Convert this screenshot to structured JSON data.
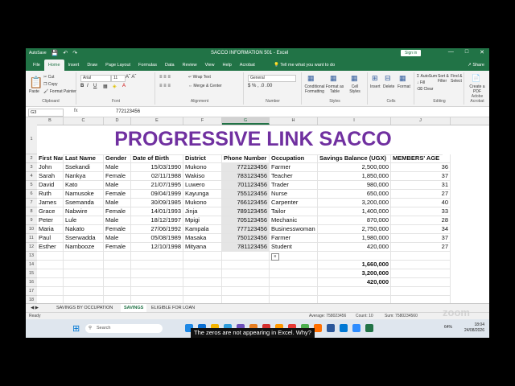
{
  "window": {
    "title": "SACCO INFORMATION 501  -  Excel",
    "search_placeholder": "Search",
    "sign_in": "Sign in",
    "autosave": "AutoSave"
  },
  "menu": {
    "tabs": [
      "File",
      "Home",
      "Insert",
      "Draw",
      "Page Layout",
      "Formulas",
      "Data",
      "Review",
      "View",
      "Help",
      "Acrobat"
    ],
    "active_tab": "Home",
    "tell_me": "Tell me what you want to do",
    "share": "Share"
  },
  "ribbon": {
    "clipboard": {
      "paste": "Paste",
      "cut": "Cut",
      "copy": "Copy",
      "format_painter": "Format Painter",
      "label": "Clipboard"
    },
    "font": {
      "name": "Arial",
      "size": "11",
      "label": "Font"
    },
    "alignment": {
      "wrap": "Wrap Text",
      "merge": "Merge & Center",
      "label": "Alignment"
    },
    "number": {
      "format": "General",
      "label": "Number"
    },
    "styles": {
      "conditional": "Conditional Formatting",
      "format_table": "Format as Table",
      "cell_styles": "Cell Styles",
      "label": "Styles"
    },
    "cells": {
      "insert": "Insert",
      "delete": "Delete",
      "format": "Format",
      "label": "Cells"
    },
    "editing": {
      "autosum": "AutoSum",
      "fill": "Fill",
      "clear": "Clear",
      "sort": "Sort & Filter",
      "find": "Find & Select",
      "label": "Editing"
    },
    "acrobat": {
      "create_pdf": "Create a PDF",
      "label": "Adobe Acrobat"
    }
  },
  "formula_bar": {
    "cell_ref": "G3",
    "fx": "fx",
    "value": "772123456"
  },
  "columns": [
    "B",
    "C",
    "D",
    "E",
    "F",
    "G",
    "H",
    "I",
    "J"
  ],
  "selected_column": "G",
  "rows": [
    "1",
    "2",
    "3",
    "4",
    "5",
    "6",
    "7",
    "8",
    "9",
    "10",
    "11",
    "12",
    "13",
    "14",
    "15",
    "16",
    "17",
    "18"
  ],
  "sheet": {
    "banner": "PROGRESSIVE LINK SACCO",
    "headers": [
      "First Name",
      "Last Name",
      "Gender",
      "Date of Birth",
      "District",
      "Phone Number",
      "Occupation",
      "Savings Balance (UGX)",
      "MEMBERS' AGE"
    ],
    "records": [
      {
        "first": "John",
        "last": "Ssekandi",
        "gender": "Male",
        "dob": "15/03/1990",
        "district": "Mukono",
        "phone": "772123456",
        "occupation": "Farmer",
        "savings": "2,500,000",
        "age": "36"
      },
      {
        "first": "Sarah",
        "last": "Nankya",
        "gender": "Female",
        "dob": "02/11/1988",
        "district": "Wakiso",
        "phone": "783123456",
        "occupation": "Teacher",
        "savings": "1,850,000",
        "age": "37"
      },
      {
        "first": "David",
        "last": "Kato",
        "gender": "Male",
        "dob": "21/07/1995",
        "district": "Luwero",
        "phone": "701123456",
        "occupation": "Trader",
        "savings": "980,000",
        "age": "31"
      },
      {
        "first": "Ruth",
        "last": "Namusoke",
        "gender": "Female",
        "dob": "09/04/1999",
        "district": "Kayunga",
        "phone": "755123456",
        "occupation": "Nurse",
        "savings": "650,000",
        "age": "27"
      },
      {
        "first": "James",
        "last": "Ssemanda",
        "gender": "Male",
        "dob": "30/09/1985",
        "district": "Mukono",
        "phone": "766123456",
        "occupation": "Carpenter",
        "savings": "3,200,000",
        "age": "40"
      },
      {
        "first": "Grace",
        "last": "Nabwire",
        "gender": "Female",
        "dob": "14/01/1993",
        "district": "Jinja",
        "phone": "789123456",
        "occupation": "Tailor",
        "savings": "1,400,000",
        "age": "33"
      },
      {
        "first": "Peter",
        "last": "Lule",
        "gender": "Male",
        "dob": "18/12/1997",
        "district": "Mpigi",
        "phone": "705123456",
        "occupation": "Mechanic",
        "savings": "870,000",
        "age": "28"
      },
      {
        "first": "Maria",
        "last": "Nakato",
        "gender": "Female",
        "dob": "27/06/1992",
        "district": "Kampala",
        "phone": "777123456",
        "occupation": "Businesswoman",
        "savings": "2,750,000",
        "age": "34"
      },
      {
        "first": "Paul",
        "last": "Sserwadda",
        "gender": "Male",
        "dob": "05/08/1989",
        "district": "Masaka",
        "phone": "750123456",
        "occupation": "Farmer",
        "savings": "1,980,000",
        "age": "37"
      },
      {
        "first": "Esther",
        "last": "Nambooze",
        "gender": "Female",
        "dob": "12/10/1998",
        "district": "Mityana",
        "phone": "781123456",
        "occupation": "Student",
        "savings": "420,000",
        "age": "27"
      }
    ],
    "totals": [
      "1,660,000",
      "3,200,000",
      "420,000"
    ]
  },
  "sheet_tabs": [
    "SAVINGS BY OCCUPATION",
    "SAVINGS",
    "ELIGIBLE FOR LOAN"
  ],
  "active_sheet": "SAVINGS",
  "status": {
    "ready": "Ready",
    "average": "Average: 758023456",
    "count": "Count: 10",
    "sum": "Sum: 7580234560"
  },
  "taskbar": {
    "search": "Search",
    "time": "18:04",
    "date": "24/08/2026",
    "battery": "64%"
  },
  "caption": "The zeros are not appearing in Excel. Why?",
  "watermark": "zoom",
  "colors": {
    "excel_green": "#217346",
    "banner_purple": "#7030a0"
  }
}
